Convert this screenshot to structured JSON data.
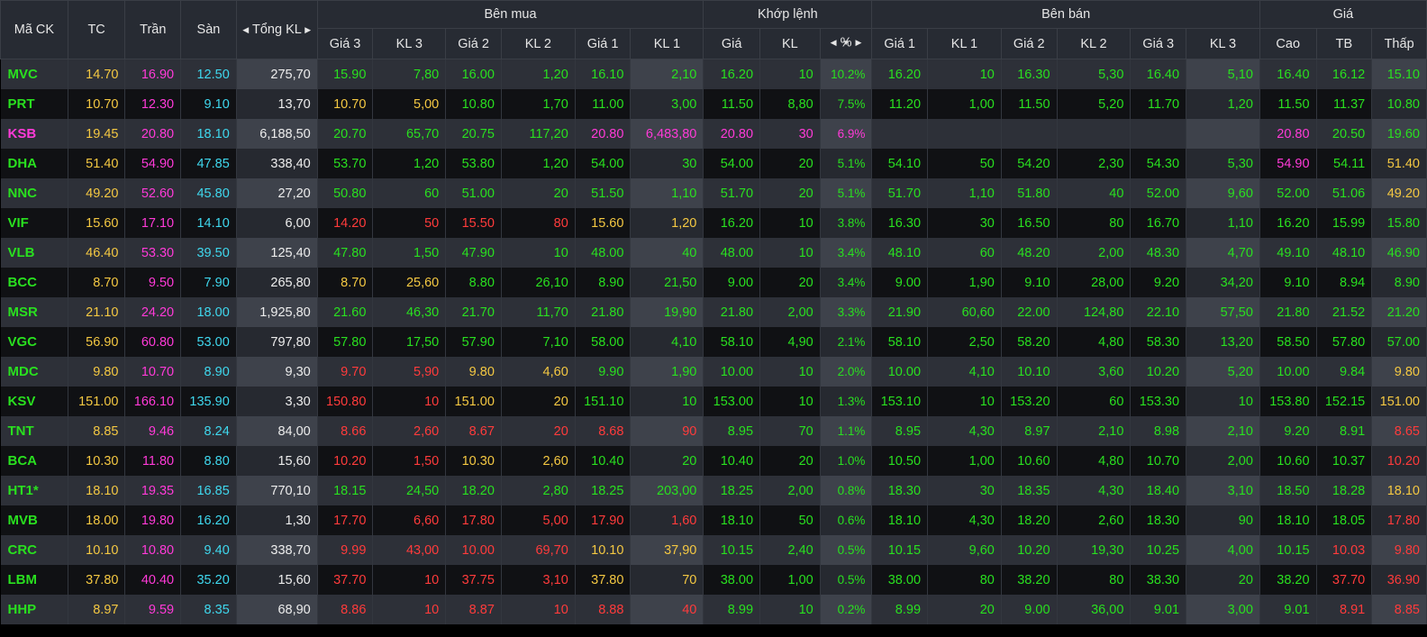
{
  "headers": {
    "symbol": "Mã CK",
    "ref": "TC",
    "ceil": "Trần",
    "floor": "Sàn",
    "total_vol": "Tổng KL",
    "buy_group": "Bên mua",
    "match_group": "Khớp lệnh",
    "sell_group": "Bên bán",
    "price_group": "Giá",
    "buy_cols": [
      "Giá 3",
      "KL 3",
      "Giá 2",
      "KL 2",
      "Giá 1",
      "KL 1"
    ],
    "match_cols": [
      "Giá",
      "KL",
      "%"
    ],
    "sell_cols": [
      "Giá 1",
      "KL 1",
      "Giá 2",
      "KL 2",
      "Giá 3",
      "KL 3"
    ],
    "price_cols": [
      "Cao",
      "TB",
      "Thấp"
    ]
  },
  "colors": {
    "gr": "#29e01f",
    "rd": "#ff3b3b",
    "yl": "#f4c842",
    "pu": "#ff3ad8",
    "cy": "#3fd8ee",
    "wh": "#ededed"
  },
  "rows": [
    {
      "c": [
        "MVC",
        "14.70",
        "16.90",
        "12.50",
        "275,70",
        "15.90",
        "7,80",
        "16.00",
        "1,20",
        "16.10",
        "2,10",
        "16.20",
        "10",
        "10.2%",
        "16.20",
        "10",
        "16.30",
        "5,30",
        "16.40",
        "5,10",
        "16.40",
        "16.12",
        "15.10"
      ],
      "k": "gyPCWgggggggggggggggggg"
    },
    {
      "c": [
        "PRT",
        "10.70",
        "12.30",
        "9.10",
        "13,70",
        "10.70",
        "5,00",
        "10.80",
        "1,70",
        "11.00",
        "3,00",
        "11.50",
        "8,80",
        "7.5%",
        "11.20",
        "1,00",
        "11.50",
        "5,20",
        "11.70",
        "1,20",
        "11.50",
        "11.37",
        "10.80"
      ],
      "k": "gyPCWyygggggggggggggggg"
    },
    {
      "c": [
        "KSB",
        "19.45",
        "20.80",
        "18.10",
        "6,188,50",
        "20.70",
        "65,70",
        "20.75",
        "117,20",
        "20.80",
        "6,483,80",
        "20.80",
        "30",
        "6.9%",
        "",
        "",
        "",
        "",
        "",
        "",
        "20.80",
        "20.50",
        "19.60"
      ],
      "k": "PyPCWggggPPPPPeeeeeePgg"
    },
    {
      "c": [
        "DHA",
        "51.40",
        "54.90",
        "47.85",
        "338,40",
        "53.70",
        "1,20",
        "53.80",
        "1,20",
        "54.00",
        "30",
        "54.00",
        "20",
        "5.1%",
        "54.10",
        "50",
        "54.20",
        "2,30",
        "54.30",
        "5,30",
        "54.90",
        "54.11",
        "51.40"
      ],
      "k": "gyPCWggggggggggggggggPgy"
    },
    {
      "c": [
        "NNC",
        "49.20",
        "52.60",
        "45.80",
        "27,20",
        "50.80",
        "60",
        "51.00",
        "20",
        "51.50",
        "1,10",
        "51.70",
        "20",
        "5.1%",
        "51.70",
        "1,10",
        "51.80",
        "40",
        "52.00",
        "9,60",
        "52.00",
        "51.06",
        "49.20"
      ],
      "k": "gyPCWgggggggggggggggggy"
    },
    {
      "c": [
        "VIF",
        "15.60",
        "17.10",
        "14.10",
        "6,00",
        "14.20",
        "50",
        "15.50",
        "80",
        "15.60",
        "1,20",
        "16.20",
        "10",
        "3.8%",
        "16.30",
        "30",
        "16.50",
        "80",
        "16.70",
        "1,10",
        "16.20",
        "15.99",
        "15.80"
      ],
      "k": "gyPCWrrrryyggggggggggggg"
    },
    {
      "c": [
        "VLB",
        "46.40",
        "53.30",
        "39.50",
        "125,40",
        "47.80",
        "1,50",
        "47.90",
        "10",
        "48.00",
        "40",
        "48.00",
        "10",
        "3.4%",
        "48.10",
        "60",
        "48.20",
        "2,00",
        "48.30",
        "4,70",
        "49.10",
        "48.10",
        "46.90"
      ],
      "k": "gyPCWgggggggggggggggggg"
    },
    {
      "c": [
        "BCC",
        "8.70",
        "9.50",
        "7.90",
        "265,80",
        "8.70",
        "25,60",
        "8.80",
        "26,10",
        "8.90",
        "21,50",
        "9.00",
        "20",
        "3.4%",
        "9.00",
        "1,90",
        "9.10",
        "28,00",
        "9.20",
        "34,20",
        "9.10",
        "8.94",
        "8.90"
      ],
      "k": "gyPCWyygggggggggggggggg"
    },
    {
      "c": [
        "MSR",
        "21.10",
        "24.20",
        "18.00",
        "1,925,80",
        "21.60",
        "46,30",
        "21.70",
        "11,70",
        "21.80",
        "19,90",
        "21.80",
        "2,00",
        "3.3%",
        "21.90",
        "60,60",
        "22.00",
        "124,80",
        "22.10",
        "57,50",
        "21.80",
        "21.52",
        "21.20"
      ],
      "k": "gyPCWgggggggggggggggggg"
    },
    {
      "c": [
        "VGC",
        "56.90",
        "60.80",
        "53.00",
        "797,80",
        "57.80",
        "17,50",
        "57.90",
        "7,10",
        "58.00",
        "4,10",
        "58.10",
        "4,90",
        "2.1%",
        "58.10",
        "2,50",
        "58.20",
        "4,80",
        "58.30",
        "13,20",
        "58.50",
        "57.80",
        "57.00"
      ],
      "k": "gyPCWgggggggggggggggggg"
    },
    {
      "c": [
        "MDC",
        "9.80",
        "10.70",
        "8.90",
        "9,30",
        "9.70",
        "5,90",
        "9.80",
        "4,60",
        "9.90",
        "1,90",
        "10.00",
        "10",
        "2.0%",
        "10.00",
        "4,10",
        "10.10",
        "3,60",
        "10.20",
        "5,20",
        "10.00",
        "9.84",
        "9.80"
      ],
      "k": "gyPCWrryyggggggggggggggy"
    },
    {
      "c": [
        "KSV",
        "151.00",
        "166.10",
        "135.90",
        "3,30",
        "150.80",
        "10",
        "151.00",
        "20",
        "151.10",
        "10",
        "153.00",
        "10",
        "1.3%",
        "153.10",
        "10",
        "153.20",
        "60",
        "153.30",
        "10",
        "153.80",
        "152.15",
        "151.00"
      ],
      "k": "gyPCWrryygggggggggggggy"
    },
    {
      "c": [
        "TNT",
        "8.85",
        "9.46",
        "8.24",
        "84,00",
        "8.66",
        "2,60",
        "8.67",
        "20",
        "8.68",
        "90",
        "8.95",
        "70",
        "1.1%",
        "8.95",
        "4,30",
        "8.97",
        "2,10",
        "8.98",
        "2,10",
        "9.20",
        "8.91",
        "8.65"
      ],
      "k": "gyPCWrrrrrrggggggggggggr"
    },
    {
      "c": [
        "BCA",
        "10.30",
        "11.80",
        "8.80",
        "15,60",
        "10.20",
        "1,50",
        "10.30",
        "2,60",
        "10.40",
        "20",
        "10.40",
        "20",
        "1.0%",
        "10.50",
        "1,00",
        "10.60",
        "4,80",
        "10.70",
        "2,00",
        "10.60",
        "10.37",
        "10.20"
      ],
      "k": "gyPCWrryyggggggggggggggr"
    },
    {
      "c": [
        "HT1*",
        "18.10",
        "19.35",
        "16.85",
        "770,10",
        "18.15",
        "24,50",
        "18.20",
        "2,80",
        "18.25",
        "203,00",
        "18.25",
        "2,00",
        "0.8%",
        "18.30",
        "30",
        "18.35",
        "4,30",
        "18.40",
        "3,10",
        "18.50",
        "18.28",
        "18.10"
      ],
      "k": "gyPCWggggggggggggggggggy"
    },
    {
      "c": [
        "MVB",
        "18.00",
        "19.80",
        "16.20",
        "1,30",
        "17.70",
        "6,60",
        "17.80",
        "5,00",
        "17.90",
        "1,60",
        "18.10",
        "50",
        "0.6%",
        "18.10",
        "4,30",
        "18.20",
        "2,60",
        "18.30",
        "90",
        "18.10",
        "18.05",
        "17.80"
      ],
      "k": "gyPCWrrrrrrggggggggggggr"
    },
    {
      "c": [
        "CRC",
        "10.10",
        "10.80",
        "9.40",
        "338,70",
        "9.99",
        "43,00",
        "10.00",
        "69,70",
        "10.10",
        "37,90",
        "10.15",
        "2,40",
        "0.5%",
        "10.15",
        "9,60",
        "10.20",
        "19,30",
        "10.25",
        "4,00",
        "10.15",
        "10.03",
        "9.80"
      ],
      "k": "gyPCWrrrryyggggggggggggrr"
    },
    {
      "c": [
        "LBM",
        "37.80",
        "40.40",
        "35.20",
        "15,60",
        "37.70",
        "10",
        "37.75",
        "3,10",
        "37.80",
        "70",
        "38.00",
        "1,00",
        "0.5%",
        "38.00",
        "80",
        "38.20",
        "80",
        "38.30",
        "20",
        "38.20",
        "37.70",
        "36.90"
      ],
      "k": "gyPCWrrrryygggggggggggrr"
    },
    {
      "c": [
        "HHP",
        "8.97",
        "9.59",
        "8.35",
        "68,90",
        "8.86",
        "10",
        "8.87",
        "10",
        "8.88",
        "40",
        "8.99",
        "10",
        "0.2%",
        "8.99",
        "20",
        "9.00",
        "36,00",
        "9.01",
        "3,00",
        "9.01",
        "8.91",
        "8.85"
      ],
      "k": "gyPCWrrrrrrggggggggggrr"
    }
  ]
}
